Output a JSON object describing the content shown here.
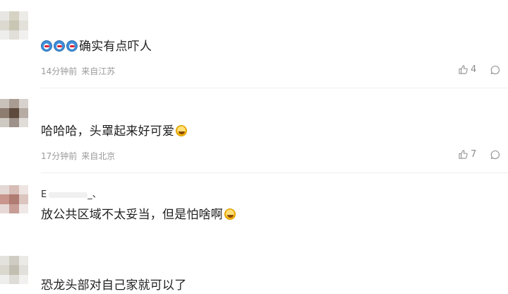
{
  "comments": [
    {
      "emoji_prefix": [
        "dog-icon",
        "dog-icon",
        "dog-icon"
      ],
      "text": "确实有点吓人",
      "time": "14分钟前",
      "source": "来自江苏",
      "likes": "4"
    },
    {
      "text": "哈哈哈，头罩起来好可爱",
      "emoji_suffix": "laugh-icon",
      "time": "17分钟前",
      "source": "来自北京",
      "likes": "7"
    },
    {
      "name_partial": "E",
      "name_tail": "_、",
      "text": "放公共区域不太妥当，但是怕啥啊",
      "emoji_suffix": "laugh-icon"
    },
    {
      "text": "恐龙头部对自己家就可以了"
    }
  ],
  "colors": {
    "meta_text": "#9a9a9a",
    "divider": "#eeeeee"
  }
}
